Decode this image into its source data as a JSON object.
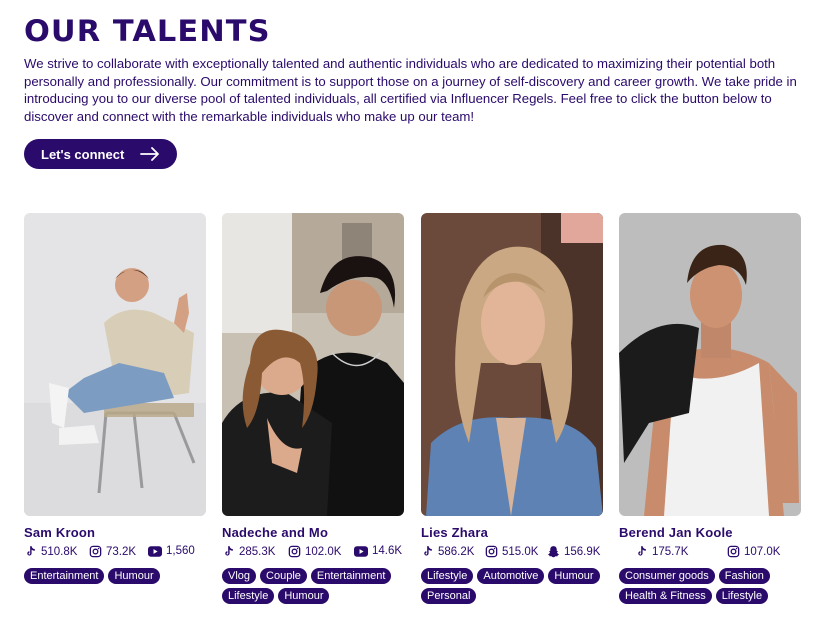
{
  "page": {
    "title": "OUR TALENTS",
    "intro": "We strive to collaborate with exceptionally talented and authentic individuals who are dedicated to maximizing their potential both personally and professionally. Our commitment is to support those on a journey of self-discovery and career growth. We take pride in introducing you to our diverse pool of talented individuals, all certified via Influencer Regels. Feel free to click the button below to discover and connect with the remarkable individuals who make up our team!",
    "cta_label": "Let's connect"
  },
  "colors": {
    "brand": "#2a0a6b",
    "tag_text": "#ffffff",
    "background": "#ffffff"
  },
  "talents": [
    {
      "name": "Sam Kroon",
      "stats": [
        {
          "icon": "tiktok-icon",
          "value": "510.8K"
        },
        {
          "icon": "instagram-icon",
          "value": "73.2K"
        },
        {
          "icon": "youtube-icon",
          "value": "1,560"
        }
      ],
      "tags": [
        "Entertainment",
        "Humour"
      ]
    },
    {
      "name": "Nadeche and Mo",
      "stats": [
        {
          "icon": "tiktok-icon",
          "value": "285.3K"
        },
        {
          "icon": "instagram-icon",
          "value": "102.0K"
        },
        {
          "icon": "youtube-icon",
          "value": "14.6K"
        }
      ],
      "tags": [
        "Vlog",
        "Couple",
        "Entertainment",
        "Lifestyle",
        "Humour"
      ]
    },
    {
      "name": "Lies Zhara",
      "stats": [
        {
          "icon": "tiktok-icon",
          "value": "586.2K"
        },
        {
          "icon": "instagram-icon",
          "value": "515.0K"
        },
        {
          "icon": "snapchat-icon",
          "value": "156.9K"
        }
      ],
      "tags": [
        "Lifestyle",
        "Automotive",
        "Humour",
        "Personal"
      ]
    },
    {
      "name": "Berend Jan Koole",
      "stats": [
        {
          "icon": "tiktok-icon",
          "value": "175.7K"
        },
        {
          "icon": "instagram-icon",
          "value": "107.0K"
        }
      ],
      "tags": [
        "Consumer goods",
        "Fashion",
        "Health & Fitness",
        "Lifestyle"
      ]
    }
  ]
}
